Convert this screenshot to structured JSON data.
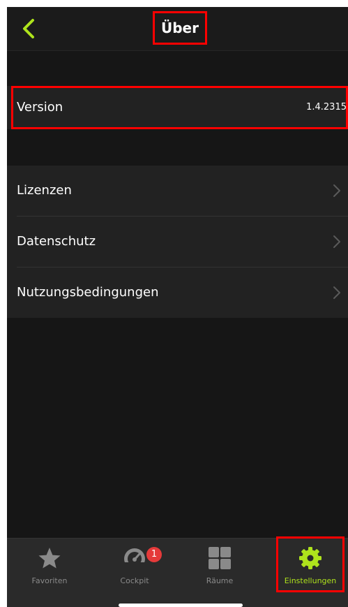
{
  "header": {
    "title": "Über",
    "back_icon": "chevron-left-icon"
  },
  "version": {
    "label": "Version",
    "value": "1.4.2315"
  },
  "links": [
    {
      "label": "Lizenzen",
      "icon": "chevron-right-icon"
    },
    {
      "label": "Datenschutz",
      "icon": "chevron-right-icon"
    },
    {
      "label": "Nutzungsbedingungen",
      "icon": "chevron-right-icon"
    }
  ],
  "tabbar": {
    "tabs": [
      {
        "label": "Favoriten",
        "icon": "star-icon",
        "active": false
      },
      {
        "label": "Cockpit",
        "icon": "speedometer-icon",
        "active": false,
        "badge": "1"
      },
      {
        "label": "Räume",
        "icon": "grid-icon",
        "active": false
      },
      {
        "label": "Einstellungen",
        "icon": "gear-icon",
        "active": true
      }
    ]
  },
  "colors": {
    "accent": "#aee31c",
    "background": "#161616",
    "section": "#222222",
    "highlight": "#ff0000",
    "badge": "#e53a3a"
  }
}
